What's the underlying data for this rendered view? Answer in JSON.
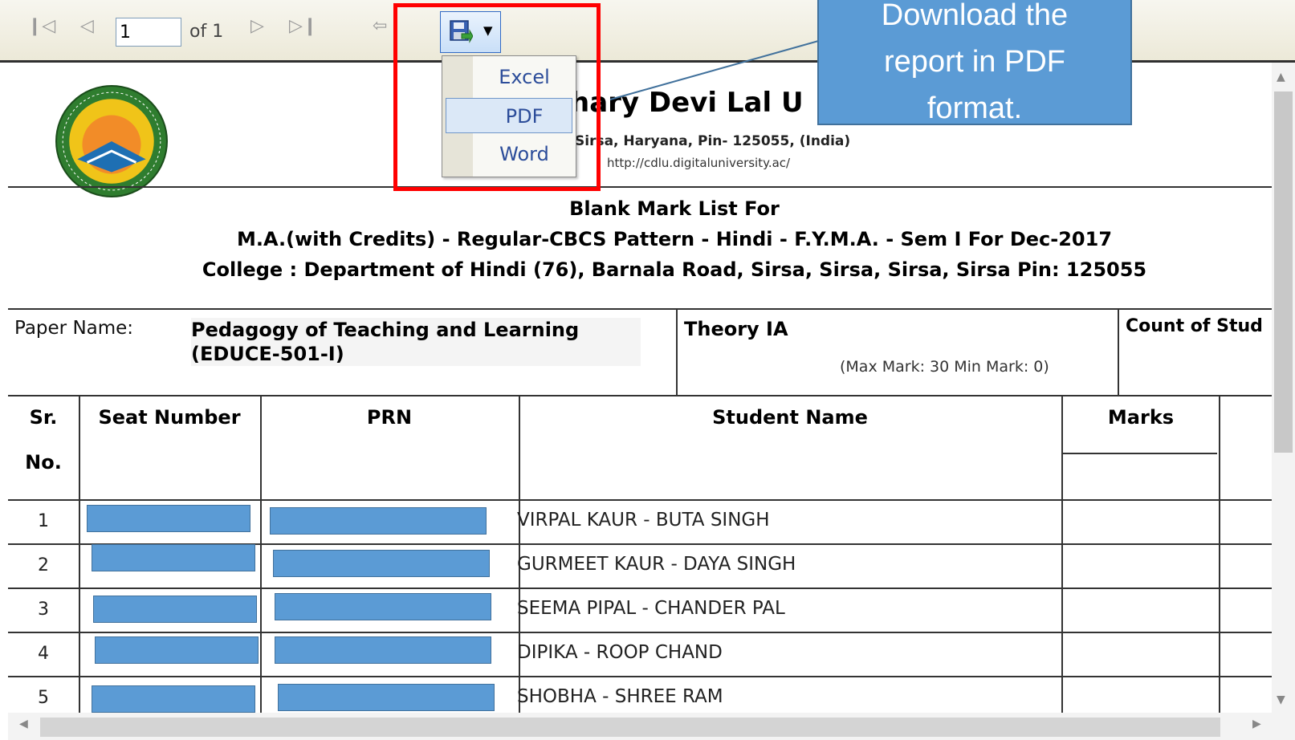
{
  "toolbar": {
    "page_value": "1",
    "page_of": "of 1",
    "icons": [
      "first-page-icon",
      "prev-page-icon",
      "next-page-icon",
      "last-page-icon",
      "back-icon",
      "export-save-icon",
      "chevron-down-icon"
    ]
  },
  "export_menu": {
    "items": [
      {
        "label": "Excel",
        "highlighted": false
      },
      {
        "label": "PDF",
        "highlighted": true
      },
      {
        "label": "Word",
        "highlighted": false
      }
    ]
  },
  "callout": {
    "lines": [
      "Download the",
      "report in PDF",
      "format."
    ],
    "color": "#5b9bd5"
  },
  "report": {
    "university_name": "hary Devi Lal U",
    "address": "Sirsa, Haryana, Pin- 125055, (India)",
    "url": "http://cdlu.digitaluniversity.ac/",
    "title_line1": "Blank Mark List For",
    "title_line2": "M.A.(with Credits) - Regular-CBCS Pattern - Hindi - F.Y.M.A. - Sem I For Dec-2017",
    "title_line3": "College : Department of Hindi (76),  Barnala Road, Sirsa, Sirsa, Sirsa, Sirsa Pin: 125055",
    "paper_label": "Paper Name:",
    "paper_name_line1": "Pedagogy of Teaching and Learning",
    "paper_name_line2": "(EDUCE-501-I)",
    "theory_label": "Theory IA",
    "max_min": "(Max Mark: 30 Min Mark: 0)",
    "count_label": "Count of Stud",
    "headers": {
      "sr_line1": "Sr.",
      "sr_line2": "No.",
      "seat": "Seat Number",
      "prn": "PRN",
      "student": "Student Name",
      "marks": "Marks"
    },
    "rows": [
      {
        "sr": "1",
        "name": "VIRPAL KAUR - BUTA SINGH"
      },
      {
        "sr": "2",
        "name": "GURMEET KAUR - DAYA SINGH"
      },
      {
        "sr": "3",
        "name": "SEEMA PIPAL - CHANDER PAL"
      },
      {
        "sr": "4",
        "name": "DIPIKA - ROOP CHAND"
      },
      {
        "sr": "5",
        "name": "SHOBHA - SHREE RAM"
      }
    ],
    "redaction_color": "#5b9bd5"
  },
  "colors": {
    "highlight_box": "#ff0000",
    "menu_text": "#2c4d9a"
  }
}
